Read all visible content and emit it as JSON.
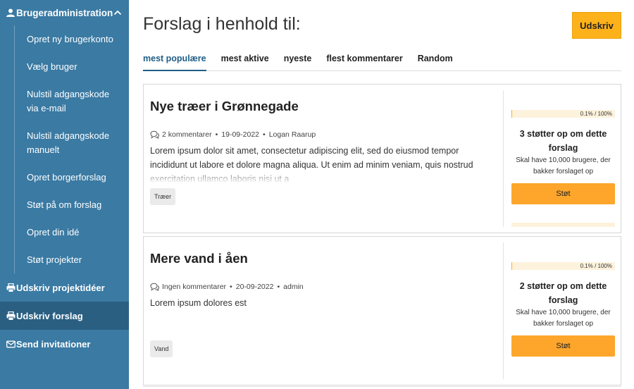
{
  "sidebar": {
    "group_title": "Brugeradministration",
    "sub_items": [
      "Opret ny brugerkonto",
      "Vælg bruger",
      "Nulstil adgangskode via e-mail",
      "Nulstil adgangskode manuelt",
      "Opret borgerforslag",
      "Støt på om forslag",
      "Opret din idé",
      "Støt projekter"
    ],
    "items": [
      {
        "label": "Udskriv projektidéer",
        "icon": "printer-icon"
      },
      {
        "label": "Udskriv forslag",
        "icon": "printer-icon",
        "active": true
      },
      {
        "label": "Send invitationer",
        "icon": "envelope-icon"
      }
    ]
  },
  "header": {
    "title": "Forslag i henhold til:",
    "print_label": "Udskriv"
  },
  "tabs": [
    "mest populære",
    "mest aktive",
    "nyeste",
    "flest kommentarer",
    "Random"
  ],
  "active_tab": "mest populære",
  "proposals": [
    {
      "title": "Nye træer i Grønnegade",
      "comments": "2 kommentarer",
      "date": "19-09-2022",
      "author": "Logan Raarup",
      "description": "Lorem ipsum dolor sit amet, consectetur adipiscing elit, sed do eiusmod tempor incididunt ut labore et dolore magna aliqua. Ut enim ad minim veniam, quis nostrud exercitation ullamco laboris nisi ut a",
      "tag": "Træer",
      "progress_label": "0.1% / 100%",
      "progress_fraction": 0.001,
      "supporters": "3 støtter op om dette forslag",
      "needs": "Skal have 10,000 brugere, der bakker forslaget op",
      "support_label": "Støt"
    },
    {
      "title": "Mere vand i åen",
      "comments": "Ingen kommentarer",
      "date": "20-09-2022",
      "author": "admin",
      "description": "Lorem ipsum dolores est",
      "tag": "Vand",
      "progress_label": "0.1% / 100%",
      "progress_fraction": 0.001,
      "supporters": "2 støtter op om dette forslag",
      "needs": "Skal have 10,000 brugere, der bakker forslaget op",
      "support_label": "Støt"
    }
  ],
  "colors": {
    "sidebar_bg": "#3a7aa3",
    "sidebar_active": "#2a5f82",
    "accent": "#fdb11a",
    "tab_active": "#1f5e87"
  }
}
